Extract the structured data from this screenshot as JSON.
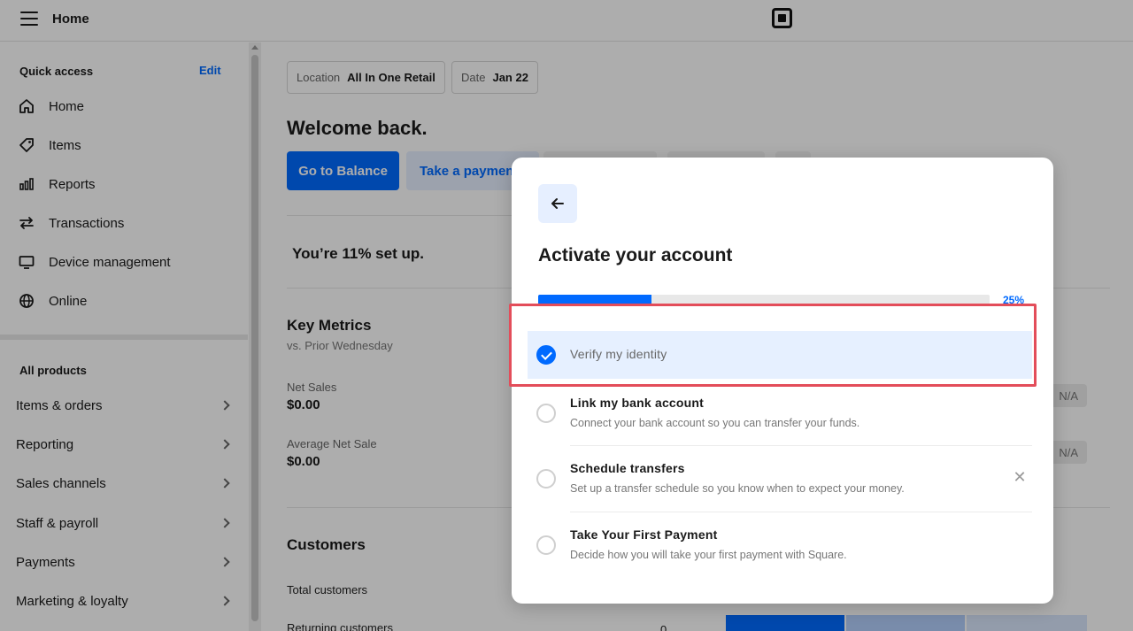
{
  "topbar": {
    "title": "Home"
  },
  "sidebar": {
    "quick_access_heading": "Quick access",
    "edit_label": "Edit",
    "quick_items": [
      {
        "label": "Home",
        "icon": "home-icon"
      },
      {
        "label": "Items",
        "icon": "tag-icon"
      },
      {
        "label": "Reports",
        "icon": "bar-chart-icon"
      },
      {
        "label": "Transactions",
        "icon": "swap-arrows-icon"
      },
      {
        "label": "Device management",
        "icon": "monitor-icon"
      },
      {
        "label": "Online",
        "icon": "globe-icon"
      }
    ],
    "all_products_heading": "All products",
    "products": [
      {
        "label": "Items & orders"
      },
      {
        "label": "Reporting"
      },
      {
        "label": "Sales channels"
      },
      {
        "label": "Staff & payroll"
      },
      {
        "label": "Payments"
      },
      {
        "label": "Marketing & loyalty"
      }
    ]
  },
  "main": {
    "location_label": "Location",
    "location_value": "All In One Retail",
    "date_label": "Date",
    "date_value": "Jan 22",
    "welcome": "Welcome back.",
    "go_to_balance": "Go to Balance",
    "take_payment": "Take a payment",
    "setup_text": "You’re 11% set up.",
    "key_metrics_title": "Key Metrics",
    "key_metrics_sub": "vs. Prior Wednesday",
    "net_sales_label": "Net Sales",
    "net_sales_value": "$0.00",
    "avg_sale_label": "Average Net Sale",
    "avg_sale_value": "$0.00",
    "na_label": "N/A",
    "customers_title": "Customers",
    "total_customers_label": "Total customers",
    "returning_customers_label": "Returning customers",
    "returning_customers_value": "0"
  },
  "modal": {
    "title": "Activate your account",
    "progress_fraction": 0.25,
    "progress_label": "25%",
    "steps": [
      {
        "title": "Verify my identity",
        "desc": "",
        "done": true
      },
      {
        "title": "Link my bank account",
        "desc": "Connect your bank account so you can transfer your funds.",
        "done": false
      },
      {
        "title": "Schedule transfers",
        "desc": "Set up a transfer schedule so you know when to expect your money.",
        "done": false
      },
      {
        "title": "Take Your First Payment",
        "desc": "Decide how you will take your first payment with Square.",
        "done": false
      }
    ]
  },
  "colors": {
    "accent": "#006aff",
    "highlight": "#e34d5a"
  }
}
